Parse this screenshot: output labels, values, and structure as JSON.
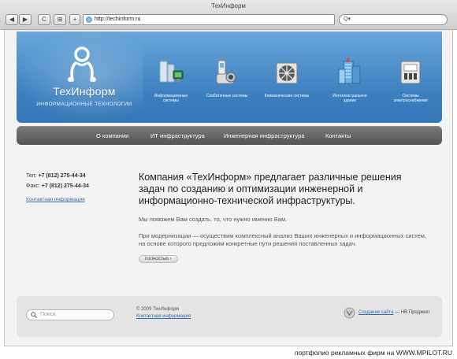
{
  "window": {
    "title": "ТехИнформ"
  },
  "toolbar": {
    "back": "◀",
    "forward": "▶",
    "reload": "C",
    "bookmark": "⊞",
    "add_tab": "+",
    "url": "http://techinform.ru",
    "search_placeholder": "Q▾"
  },
  "brand": {
    "name": "ТехИнформ",
    "tagline": "ИНФОРМАЦИОННЫЕ ТЕХНОЛОГИИ"
  },
  "services": [
    {
      "label": "Информационные системы",
      "icon": "servers-icon"
    },
    {
      "label": "Слаботочные системы",
      "icon": "camera-phone-icon"
    },
    {
      "label": "Климатические системы",
      "icon": "air-conditioner-icon"
    },
    {
      "label": "Интеллектуальное здание",
      "icon": "building-icon"
    },
    {
      "label": "Системы электроснабжения",
      "icon": "power-cabinet-icon"
    }
  ],
  "menu": [
    "О компании",
    "ИТ инфраструктура",
    "Инженерная инфраструктура",
    "Контакты"
  ],
  "contacts": {
    "tel_label": "Тел:",
    "tel": "+7 (812) 275-44-34",
    "fax_label": "Факс:",
    "fax": "+7 (812) 275-44-34",
    "link": "Контактная информация"
  },
  "main": {
    "headline": "Компания «ТехИнформ» предлагает различные решения задач по созданию и оптимизации инженерной и информационно-технической инфраструктуры.",
    "p1": "Мы поможем Вам создать, то, что нужно именно Вам.",
    "p2": "При модернизации — осуществим комплексный анализ Ваших инженерных и информационных систем, на основе которого предложим конкретные пути решения поставленных задач.",
    "more": "полностью ›"
  },
  "footer": {
    "search_placeholder": "Поиск",
    "copyright": "© 2009 ТехИнформ",
    "contact_link": "Контактная информация",
    "credit_link": "Создание сайта",
    "credit_rest": " — НВ Проджект"
  },
  "watermark": "портфолио рекламных фирм на WWW.MPILOT.RU",
  "colors": {
    "banner": "#4a8dcb",
    "menubar": "#5e5e5e",
    "link": "#2f6fb0"
  }
}
